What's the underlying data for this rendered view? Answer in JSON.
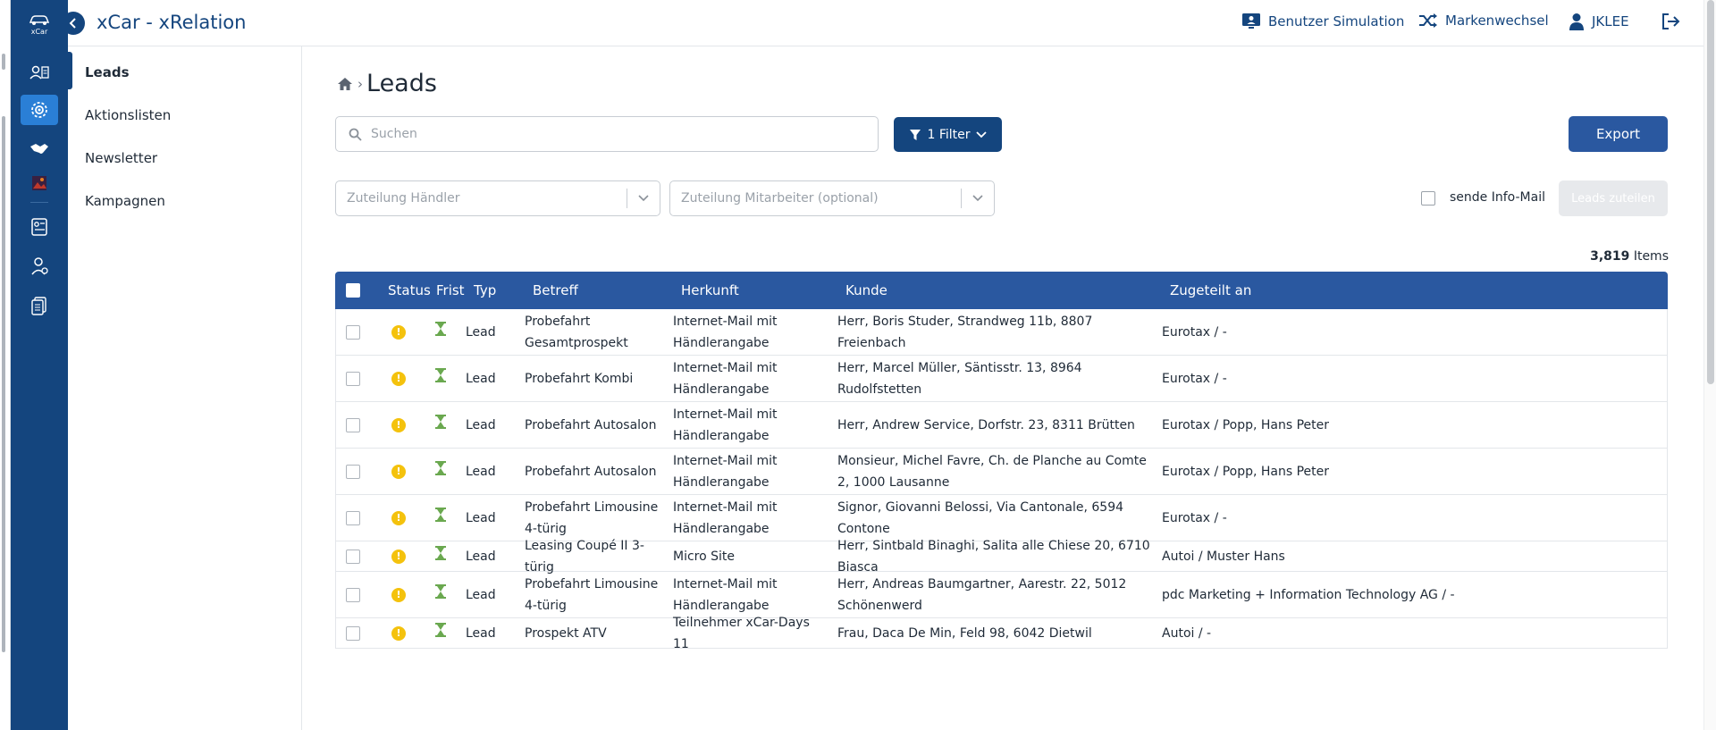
{
  "app": {
    "title": "xCar - xRelation",
    "logo_text": "xCar"
  },
  "header": {
    "user_simulation": "Benutzer Simulation",
    "brand_switch": "Markenwechsel",
    "username": "JKLEE"
  },
  "subnav": {
    "items": [
      {
        "label": "Leads",
        "active": true
      },
      {
        "label": "Aktionslisten",
        "active": false
      },
      {
        "label": "Newsletter",
        "active": false
      },
      {
        "label": "Kampagnen",
        "active": false
      }
    ]
  },
  "page": {
    "title": "Leads"
  },
  "search": {
    "placeholder": "Suchen",
    "value": ""
  },
  "filter": {
    "label": "1 Filter"
  },
  "export": {
    "label": "Export"
  },
  "assign": {
    "dealer_placeholder": "Zuteilung Händler",
    "employee_placeholder": "Zuteilung Mitarbeiter (optional)",
    "info_mail_label": "sende Info-Mail",
    "assign_button": "Leads zuteilen"
  },
  "count": {
    "value": "3,819",
    "unit": "Items"
  },
  "table": {
    "columns": [
      "Status",
      "Frist",
      "Typ",
      "Betreff",
      "Herkunft",
      "Kunde",
      "Zugeteilt an"
    ],
    "rows": [
      {
        "typ": "Lead",
        "betreff": "Probefahrt Gesamtprospekt",
        "herkunft": "Internet-Mail mit Händlerangabe",
        "kunde": "Herr, Boris Studer, Strandweg 11b, 8807 Freienbach",
        "zugeteilt": "Eurotax / -"
      },
      {
        "typ": "Lead",
        "betreff": "Probefahrt Kombi",
        "herkunft": "Internet-Mail mit Händlerangabe",
        "kunde": "Herr, Marcel Müller, Säntisstr. 13, 8964 Rudolfstetten",
        "zugeteilt": "Eurotax / -"
      },
      {
        "typ": "Lead",
        "betreff": "Probefahrt Autosalon",
        "herkunft": "Internet-Mail mit Händlerangabe",
        "kunde": "Herr, Andrew Service, Dorfstr. 23, 8311 Brütten",
        "zugeteilt": "Eurotax / Popp, Hans Peter"
      },
      {
        "typ": "Lead",
        "betreff": "Probefahrt Autosalon",
        "herkunft": "Internet-Mail mit Händlerangabe",
        "kunde": "Monsieur, Michel Favre, Ch. de Planche au Comte 2, 1000 Lausanne",
        "zugeteilt": "Eurotax / Popp, Hans Peter"
      },
      {
        "typ": "Lead",
        "betreff": "Probefahrt Limousine 4-türig",
        "herkunft": "Internet-Mail mit Händlerangabe",
        "kunde": "Signor, Giovanni Belossi, Via Cantonale, 6594 Contone",
        "zugeteilt": "Eurotax / -"
      },
      {
        "typ": "Lead",
        "betreff": "Leasing Coupé II 3-türig",
        "herkunft": "Micro Site",
        "kunde": "Herr, Sintbald Binaghi, Salita alle Chiese 20, 6710 Biasca",
        "zugeteilt": "Autoi / Muster Hans"
      },
      {
        "typ": "Lead",
        "betreff": "Probefahrt Limousine 4-türig",
        "herkunft": "Internet-Mail mit Händlerangabe",
        "kunde": "Herr, Andreas Baumgartner, Aarestr. 22, 5012 Schönenwerd",
        "zugeteilt": "pdc Marketing + Information Technology AG / -"
      },
      {
        "typ": "Lead",
        "betreff": "Prospekt ATV",
        "herkunft": "Teilnehmer xCar-Days 11",
        "kunde": "Frau, Daca De Min, Feld 98, 6042 Dietwil",
        "zugeteilt": "Autoi / -"
      }
    ]
  },
  "colors": {
    "brand_dark": "#14457e",
    "brand_mid": "#2a58a0",
    "status_warning": "#f4c20d",
    "deadline_ok": "#6aa84f"
  },
  "icons": {
    "status": "exclamation-circle-icon",
    "deadline": "hourglass-icon"
  }
}
